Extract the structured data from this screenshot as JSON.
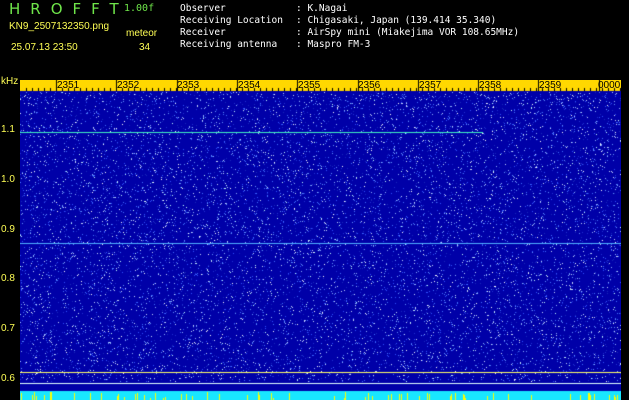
{
  "header": {
    "app_title": "HROFFT",
    "version": "1.00f",
    "filename": "KN9_2507132350.png",
    "datetime": "25.07.13 23:50",
    "meteor_label": "meteor",
    "meteor_count": "34"
  },
  "info": [
    {
      "label": "Observer",
      "value": ": K.Nagai"
    },
    {
      "label": "Receiving Location",
      "value": ": Chigasaki, Japan (139.414 35.340)"
    },
    {
      "label": "Receiver",
      "value": ": AirSpy mini (Miakejima VOR 108.65MHz)"
    },
    {
      "label": "Receiving antenna",
      "value": ": Maspro FM-3"
    }
  ],
  "spectrogram": {
    "y_unit": "kHz",
    "y_ticks": [
      "1.1",
      "1.0",
      "0.9",
      "0.8",
      "0.7",
      "0.6"
    ],
    "y_range": [
      0.565,
      1.205
    ],
    "x_ticks": [
      "2351",
      "2352",
      "2353",
      "2354",
      "2355",
      "2356",
      "2357",
      "2358",
      "2359",
      "0000"
    ],
    "trace_lines": [
      {
        "freq": 1.1,
        "t_start": 0.0,
        "t_end": 0.77,
        "color": "#3ff0c0"
      },
      {
        "freq": 0.88,
        "t_start": 0.0,
        "t_end": 1.0,
        "color": "#4fb0ff"
      },
      {
        "freq": 0.62,
        "t_start": 0.0,
        "t_end": 1.0,
        "color": "#ffff66"
      },
      {
        "freq": 0.6,
        "t_start": 0.0,
        "t_end": 1.0,
        "color": "#e0ffff"
      }
    ],
    "colors": {
      "background": "#0000a8",
      "noise": "#3a5cff",
      "tick_bar": "#ffd800",
      "bottom_band": "#19e7ff",
      "bottom_spike": "#ffff00"
    }
  }
}
